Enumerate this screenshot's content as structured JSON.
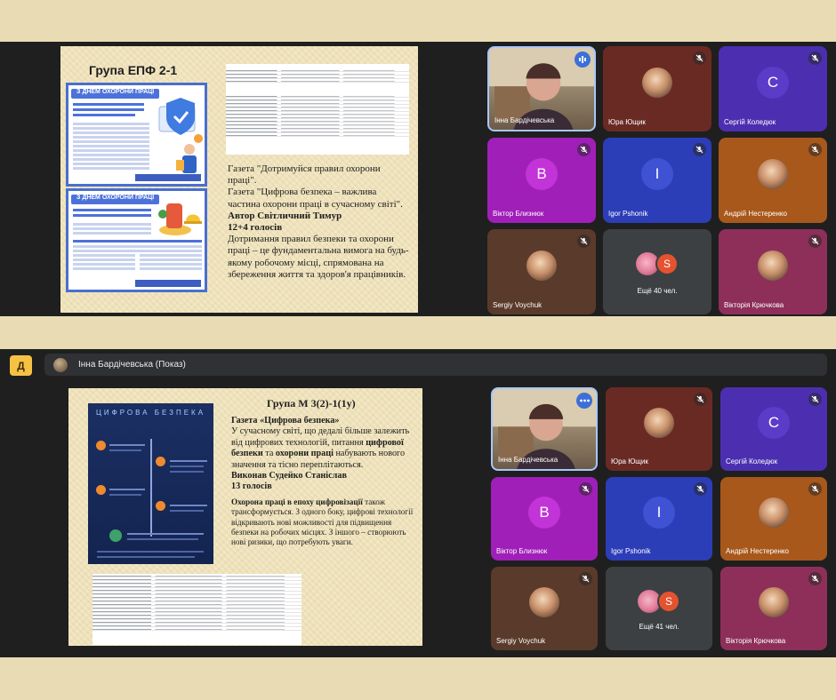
{
  "panel2_header": {
    "title": "Інна Бардічевська (Показ)",
    "logo_glyph": "Д",
    "logo_color": "#f6c244"
  },
  "slide1": {
    "heading": "Група ЕПФ 2-1",
    "poster_top_banner": "З ДНЕМ ОХОРОНИ ПРАЦІ",
    "poster_bottom_banner": "З ДНЕМ ОХОРОНИ ПРАЦІ",
    "text": {
      "line1": "Газета \"Дотримуйся правил охорони праці\".",
      "line2": "Газета \"Цифрова безпека – важлива частина охорони праці в сучасному світі\".",
      "author": "Автор Світличний Тимур",
      "votes": "12+4 голосів",
      "body": "Дотримання правил безпеки та охорони праці – це фундаментальна вимога на будь-якому робочому місці, спрямована на збереження життя та здоров'я працівників."
    }
  },
  "slide2": {
    "heading": "Група М 3(2)-1(1у)",
    "infographic_title": "ЦИФРОВА БЕЗПЕКА",
    "text": {
      "newspaper": "Газета «Цифрова безпека»",
      "p1_before": "У сучасному світі, що дедалі більше залежить від цифрових технологій, питання ",
      "p1_bold1": "цифрової безпеки",
      "p1_mid": " та ",
      "p1_bold2": "охорони праці",
      "p1_after": " набувають нового значення та тісно переплітаються.",
      "author": "Виконав Судейко Станіслав",
      "votes": "13 голосів",
      "p2_bold": "Охорона праці в епоху цифровізації",
      "p2_rest": " також трансформується. З одного боку, цифрові технології відкривають нові можливості для підвищення безпеки на робочих місцях. З іншого – створюють нові ризики, що потребують уваги."
    }
  },
  "participants1": [
    {
      "name": "Інна Бардічевська",
      "kind": "video",
      "badge": "speaking"
    },
    {
      "name": "Юра Ющик",
      "kind": "image",
      "bg": "#6a2a24",
      "badge": "muted"
    },
    {
      "name": "Сергій Коледюк",
      "kind": "letter",
      "letter": "С",
      "bg": "#4b2fb0",
      "avatar": "#5a3cc9",
      "badge": "muted"
    },
    {
      "name": "Віктор Близнюк",
      "kind": "letter",
      "letter": "В",
      "bg": "#a01fb8",
      "avatar": "#c233d8",
      "badge": "muted"
    },
    {
      "name": "Igor Pshonik",
      "kind": "letter",
      "letter": "I",
      "bg": "#2c3db8",
      "avatar": "#3f52d4",
      "badge": "muted"
    },
    {
      "name": "Андрій Нестеренко",
      "kind": "image",
      "bg": "#a8581b",
      "badge": "muted"
    },
    {
      "name": "Sergiy Voychuk",
      "kind": "image",
      "bg": "#5a3a2a",
      "badge": "muted"
    },
    {
      "name": "Ещё 40 чел.",
      "kind": "more",
      "letter": "S"
    },
    {
      "name": "Вікторія Крючкова",
      "kind": "image",
      "bg": "#8e2f5a",
      "badge": "muted"
    }
  ],
  "participants2": [
    {
      "name": "Інна Бардічевська",
      "kind": "video",
      "badge": "more"
    },
    {
      "name": "Юра Ющик",
      "kind": "image",
      "bg": "#6a2a24",
      "badge": "muted"
    },
    {
      "name": "Сергій Коледюк",
      "kind": "letter",
      "letter": "С",
      "bg": "#4b2fb0",
      "avatar": "#5a3cc9",
      "badge": "muted"
    },
    {
      "name": "Віктор Близнюк",
      "kind": "letter",
      "letter": "В",
      "bg": "#a01fb8",
      "avatar": "#c233d8",
      "badge": "muted"
    },
    {
      "name": "Igor Pshonik",
      "kind": "letter",
      "letter": "I",
      "bg": "#2c3db8",
      "avatar": "#3f52d4",
      "badge": "muted"
    },
    {
      "name": "Андрій Нестеренко",
      "kind": "image",
      "bg": "#a8581b",
      "badge": "muted"
    },
    {
      "name": "Sergiy Voychuk",
      "kind": "image",
      "bg": "#5a3a2a",
      "badge": "muted"
    },
    {
      "name": "Ещё 41 чел.",
      "kind": "more",
      "letter": "S"
    },
    {
      "name": "Вікторія Крючкова",
      "kind": "image",
      "bg": "#8e2f5a",
      "badge": "muted"
    }
  ],
  "colors": {
    "frame_bg": "#e9dcb5",
    "panel_bg": "#1f1f1f",
    "active_speaker_border": "#a8c7fa"
  }
}
